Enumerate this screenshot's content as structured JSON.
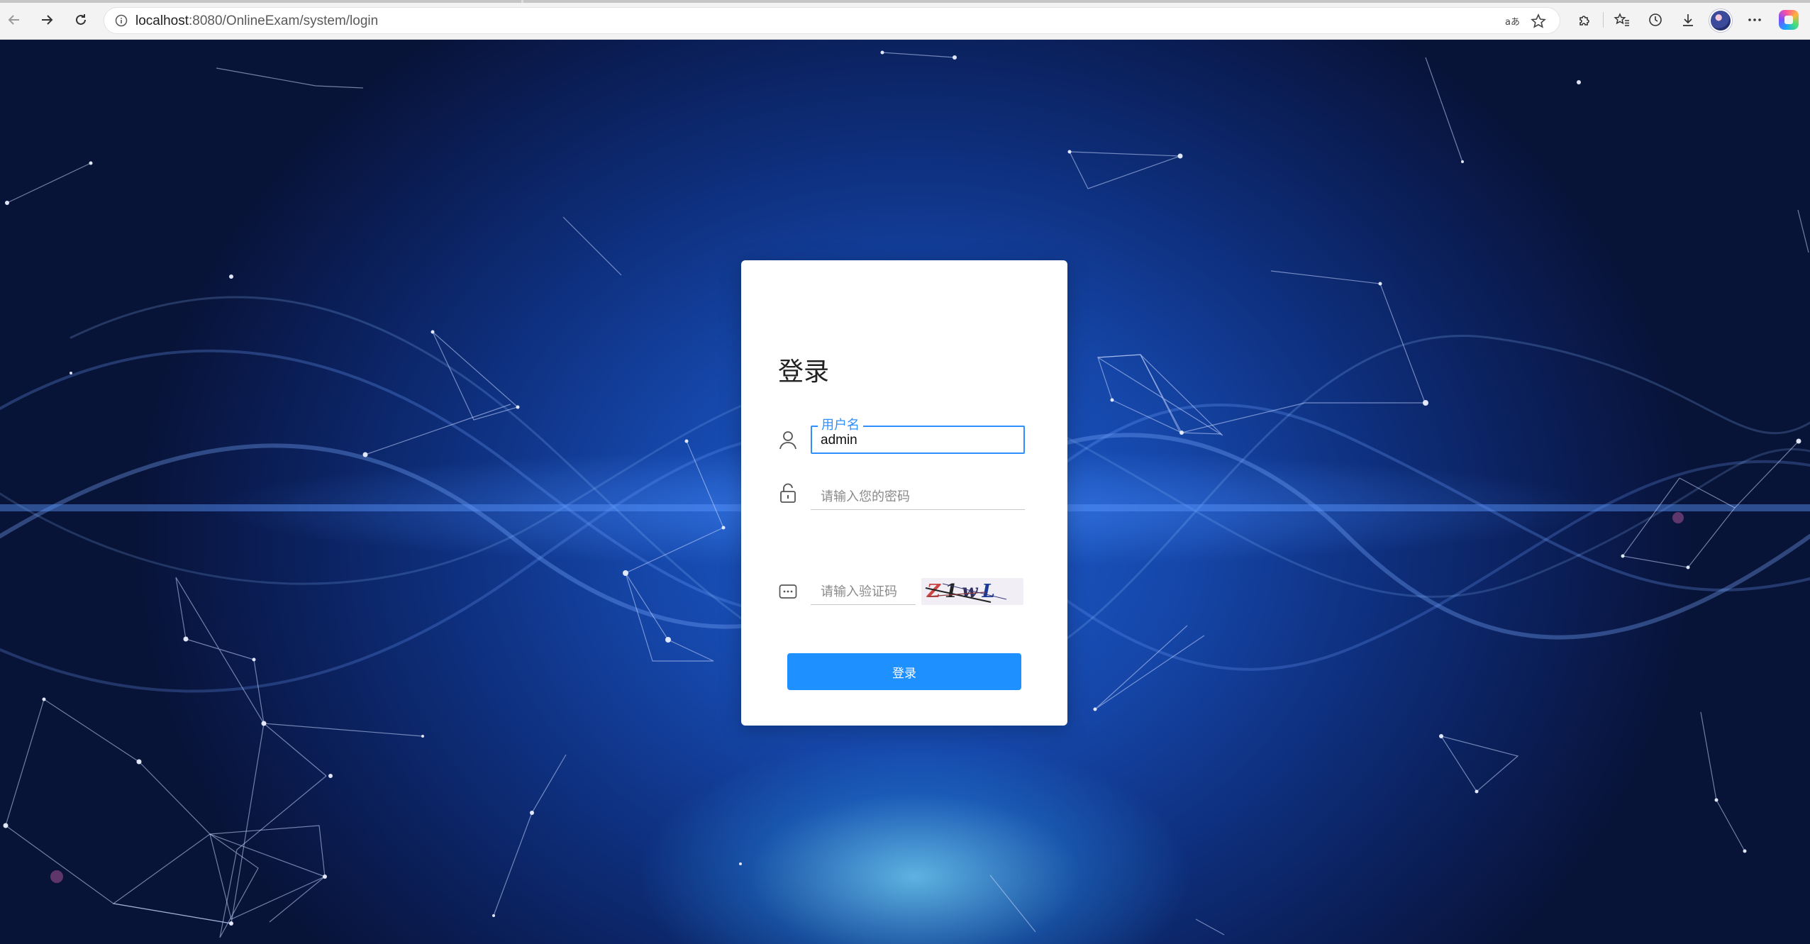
{
  "browser": {
    "url_host": "localhost",
    "url_path": ":8080/OnlineExam/system/login",
    "icons": {
      "back": "back-arrow-icon",
      "forward": "forward-arrow-icon",
      "reload": "reload-icon",
      "site_info": "info-icon",
      "read_aloud": "read-aloud-icon",
      "favorite": "star-icon",
      "extensions": "puzzle-icon",
      "favorites": "favorites-icon",
      "history": "history-icon",
      "downloads": "download-icon",
      "profile": "avatar",
      "more": "more-icon",
      "copilot": "copilot-icon"
    }
  },
  "login": {
    "title": "登录",
    "username_label": "用户名",
    "username_value": "admin",
    "password_placeholder": "请输入您的密码",
    "captcha_placeholder": "请输入验证码",
    "captcha_chars": [
      "Z",
      "1",
      "w",
      "L"
    ],
    "submit_label": "登录"
  },
  "colors": {
    "accent": "#1e90ff",
    "focus_border": "#2f8fff",
    "background_deep": "#0a1c52",
    "background_glow": "#1e5fd0"
  }
}
